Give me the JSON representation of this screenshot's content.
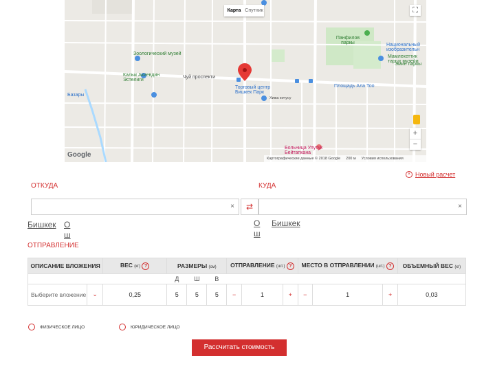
{
  "map": {
    "type_map": "Карта",
    "type_sat": "Спутник",
    "zoom_in": "+",
    "zoom_out": "−",
    "logo": "Google",
    "footer": "Картографические данные © 2018 Google",
    "scale": "200 м",
    "terms": "Условия использования",
    "labels": [
      "Панфилов паркы",
      "Национальный изобразительн",
      "Зоологический музей",
      "Мамлекеттик тарых музейи",
      "Калык Акиевдин Эстелиги",
      "Эмин паркы",
      "Чуй проспекти",
      "Торговый центр Бишкек Парк",
      "Площадь Ала Тоо",
      "Базары",
      "Больница Улутук Бейтапкана",
      "Хижа кочусу"
    ]
  },
  "new_calc": "Новый расчет",
  "from": {
    "title": "ОТКУДА",
    "value": "",
    "clear": "×",
    "cities": [
      "Бишкек",
      "Ош"
    ]
  },
  "to": {
    "title": "КУДА",
    "value": "",
    "clear": "×",
    "cities": [
      "Ош",
      "Бишкек"
    ]
  },
  "swap": "⇄",
  "shipment": {
    "title": "ОТПРАВЛЕНИЕ",
    "headers": {
      "desc": "ОПИСАНИЕ ВЛОЖЕНИЯ",
      "weight": "ВЕС",
      "weight_unit": "(кг)",
      "dims": "РАЗМЕРЫ",
      "dims_unit": "(см)",
      "qty": "ОТПРАВЛЕНИЕ",
      "qty_unit": "(шт.)",
      "places": "МЕСТО В ОТПРАВЛЕНИИ",
      "places_unit": "(шт.)",
      "volume": "ОБЪЕМНЫЙ ВЕС",
      "volume_unit": "(кг)",
      "help": "?"
    },
    "dim_labels": [
      "Д",
      "Ш",
      "В"
    ],
    "row": {
      "desc_placeholder": "Выберите вложение",
      "weight": "0,25",
      "d": "5",
      "w": "5",
      "h": "5",
      "qty": "1",
      "places": "1",
      "volume": "0,03",
      "minus": "−",
      "plus": "+"
    }
  },
  "person_types": [
    "ФИЗИЧЕСКОЕ ЛИЦО",
    "ЮРИДИЧЕСКОЕ ЛИЦО"
  ],
  "calc_button": "Рассчитать стоимость",
  "colors": {
    "accent": "#d32f2f",
    "marker": "#e53935"
  }
}
